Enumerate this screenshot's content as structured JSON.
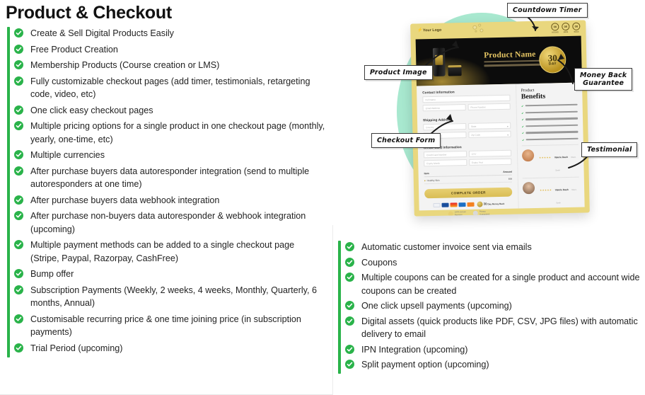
{
  "page_title": "Product & Checkout",
  "accent": {
    "green": "#2ab34a",
    "gold": "#e9d77e",
    "mint": "#a8e8cf",
    "black": "#0c0c0c"
  },
  "left_column": {
    "icon": "check-circle-icon",
    "items": [
      "Create & Sell Digital Products Easily",
      "Free Product Creation",
      "Membership Products (Course creation or LMS)",
      "Fully customizable checkout pages (add timer, testimonials, retargeting code, video, etc)",
      "One click easy checkout pages",
      "Multiple pricing options for a single product in one checkout page (monthly, yearly, one-time, etc)",
      "Multiple currencies",
      "After purchase buyers data autoresponder integration (send to multiple autoresponders at one time)",
      "After purchase buyers data webhook integration",
      "After purchase non-buyers data autoresponder & webhook integration (upcoming)",
      "Multiple payment methods can be added to a single checkout page (Stripe, Paypal, Razorpay, CashFree)",
      "Bump offer",
      "Subscription Payments (Weekly, 2 weeks, 4 weeks, Monthly, Quarterly, 6 months, Annual)",
      "Customisable recurring price & one time joining price (in subscription payments)",
      "Trial Period (upcoming)"
    ]
  },
  "right_column": {
    "icon": "check-circle-icon",
    "items": [
      "Automatic customer invoice sent via emails",
      "Coupons",
      "Multiple coupons can be created for a single product and account wide coupons can be created",
      "One click upsell payments (upcoming)",
      "Digital assets (quick products like PDF, CSV, JPG files) with automatic delivery to email",
      "IPN Integration (upcoming)",
      "Split payment option (upcoming)"
    ]
  },
  "callouts": [
    {
      "id": "countdown",
      "label": "Countdown Timer"
    },
    {
      "id": "product_image",
      "label": "Product Image"
    },
    {
      "id": "money_back",
      "label": "Money Back\nGuarantee"
    },
    {
      "id": "checkout_form",
      "label": "Checkout Form"
    },
    {
      "id": "testimonial",
      "label": "Testimonial"
    }
  ],
  "mockup": {
    "logo": "Your Logo",
    "timers": [
      {
        "value": "00",
        "label": "HOURS"
      },
      {
        "value": "00",
        "label": "MINS"
      },
      {
        "value": "00",
        "label": "SECS"
      }
    ],
    "hero": {
      "title": "Product Name",
      "badge_number": "30",
      "badge_unit": "DAY"
    },
    "form": {
      "contact_heading": "Contact Information",
      "full_name_placeholder": "Full Name",
      "email_placeholder": "Email Address",
      "phone_placeholder": "Phone Number",
      "shipping_heading": "Shipping Address",
      "country_placeholder": "Country",
      "state_placeholder": "State",
      "city_placeholder": "City",
      "zip_placeholder": "Zip Code",
      "card_heading": "Credit Card Information",
      "card_number_placeholder": "Credit Card Number",
      "cvv_placeholder": "CVV",
      "expiry_month_placeholder": "Expiry Month",
      "expiry_year_placeholder": "Expiry Year",
      "item_header": "Item",
      "amount_header": "Amount",
      "item_name": "Healthy Skin",
      "item_amount": "$99",
      "order_button": "COMPLETE ORDER",
      "guarantee_number": "30",
      "guarantee_line1": "Day Money Back",
      "guarantee_line2": "Guarantee",
      "trust_lock_line1": "100% Secure",
      "trust_lock_line2": "Payment",
      "trust_shield_line1": "Privacy",
      "trust_shield_line2": "Guaranteed"
    },
    "benefits": {
      "heading_small": "Product",
      "heading_large": "Benefits",
      "count": 6
    },
    "testimonials": [
      {
        "stars": "★★★★★",
        "name": "Valerie Dash",
        "role": "Client, Spain"
      },
      {
        "stars": "★★★★★",
        "name": "Valerie Dash",
        "role": "Client, Spain"
      }
    ]
  }
}
